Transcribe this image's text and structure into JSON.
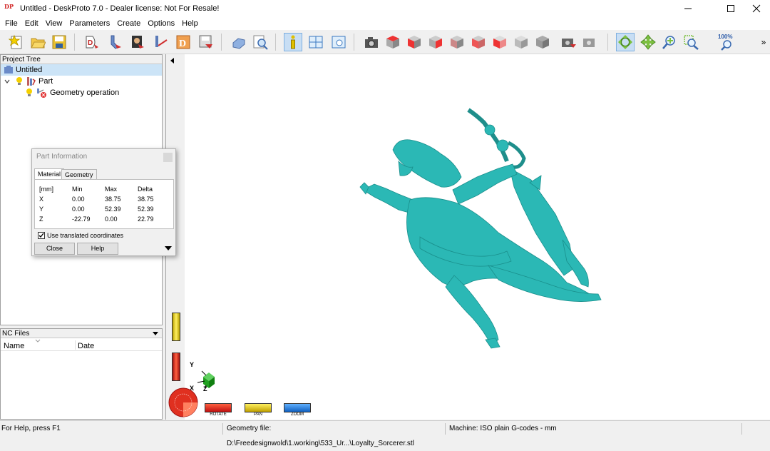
{
  "window": {
    "logo_text": "DP",
    "title": "Untitled - DeskProto 7.0 - Dealer license: Not For Resale!",
    "controls": [
      "minimize-icon",
      "maximize-icon",
      "close-icon"
    ]
  },
  "menu": [
    "File",
    "Edit",
    "View",
    "Parameters",
    "Create",
    "Options",
    "Help"
  ],
  "toolbar": {
    "zoom_percent": "100%",
    "more": "»"
  },
  "project_tree": {
    "header": "Project Tree",
    "items": [
      {
        "label": "Untitled",
        "icon": "project-icon"
      },
      {
        "label": "Part",
        "icon": "part-icon"
      },
      {
        "label": "Geometry operation",
        "icon": "geometry-operation-icon"
      }
    ]
  },
  "nc_files": {
    "header": "NC Files",
    "columns": [
      "Name",
      "Date"
    ]
  },
  "part_info": {
    "title": "Part Information",
    "tabs": [
      "Material",
      "Geometry"
    ],
    "headers": [
      "[mm]",
      "Min",
      "Max",
      "Delta"
    ],
    "rows": [
      [
        "X",
        "0.00",
        "38.75",
        "38.75"
      ],
      [
        "Y",
        "0.00",
        "52.39",
        "52.39"
      ],
      [
        "Z",
        "-22.79",
        "0.00",
        "22.79"
      ]
    ],
    "checkbox_label": "Use translated coordinates",
    "checkbox_checked": true,
    "close_label": "Close",
    "help_label": "Help"
  },
  "viewport": {
    "model_color": "#2bb8b5",
    "axis_labels": {
      "x": "X",
      "y": "Y",
      "z": "Z"
    },
    "modes": [
      "ROTATE",
      "PAN",
      "ZOOM"
    ]
  },
  "status": {
    "help": "For Help, press F1",
    "geometry_file": "Geometry file: D:\\Freedesignwold\\1.working\\533_Ur...\\Loyalty_Sorcerer.stl",
    "machine": "Machine: ISO plain G-codes - mm"
  }
}
